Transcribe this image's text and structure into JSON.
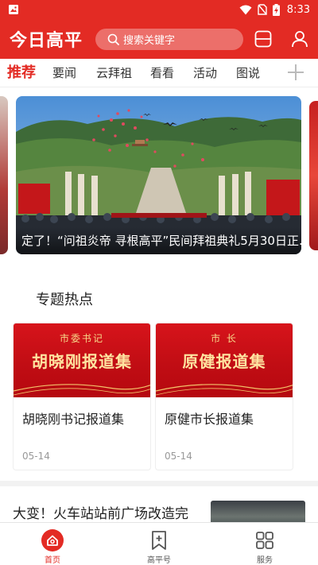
{
  "status_bar": {
    "time": "8:33"
  },
  "header": {
    "logo_text": "今日高平",
    "search_placeholder": "搜索关键字",
    "icons": [
      "search-icon",
      "scan-icon",
      "user-icon"
    ]
  },
  "tabs": [
    {
      "label": "推荐",
      "active": true
    },
    {
      "label": "要闻",
      "active": false
    },
    {
      "label": "云拜祖",
      "active": false
    },
    {
      "label": "看看",
      "active": false
    },
    {
      "label": "活动",
      "active": false
    },
    {
      "label": "图说",
      "active": false
    }
  ],
  "carousel": {
    "caption": "定了！“问祖炎帝 寻根高平”民间拜祖典礼5月30日正..."
  },
  "topics": {
    "title": "专题热点",
    "items": [
      {
        "banner_sub": "市委书记",
        "banner_main": "胡晓刚报道集",
        "title": "胡晓刚书记报道集",
        "date": "05-14"
      },
      {
        "banner_sub": "市  长",
        "banner_main": "原健报道集",
        "title": "原健市长报道集",
        "date": "05-14"
      }
    ]
  },
  "news": [
    {
      "title": "大变！火车站站前广场改造完"
    }
  ],
  "bottom_nav": [
    {
      "label": "首页",
      "icon": "home-icon",
      "active": true
    },
    {
      "label": "高平号",
      "icon": "bookmark-add-icon",
      "active": false
    },
    {
      "label": "服务",
      "icon": "grid-icon",
      "active": false
    }
  ],
  "colors": {
    "brand_red": "#e32b24",
    "banner_gold": "#ffe3a0"
  }
}
